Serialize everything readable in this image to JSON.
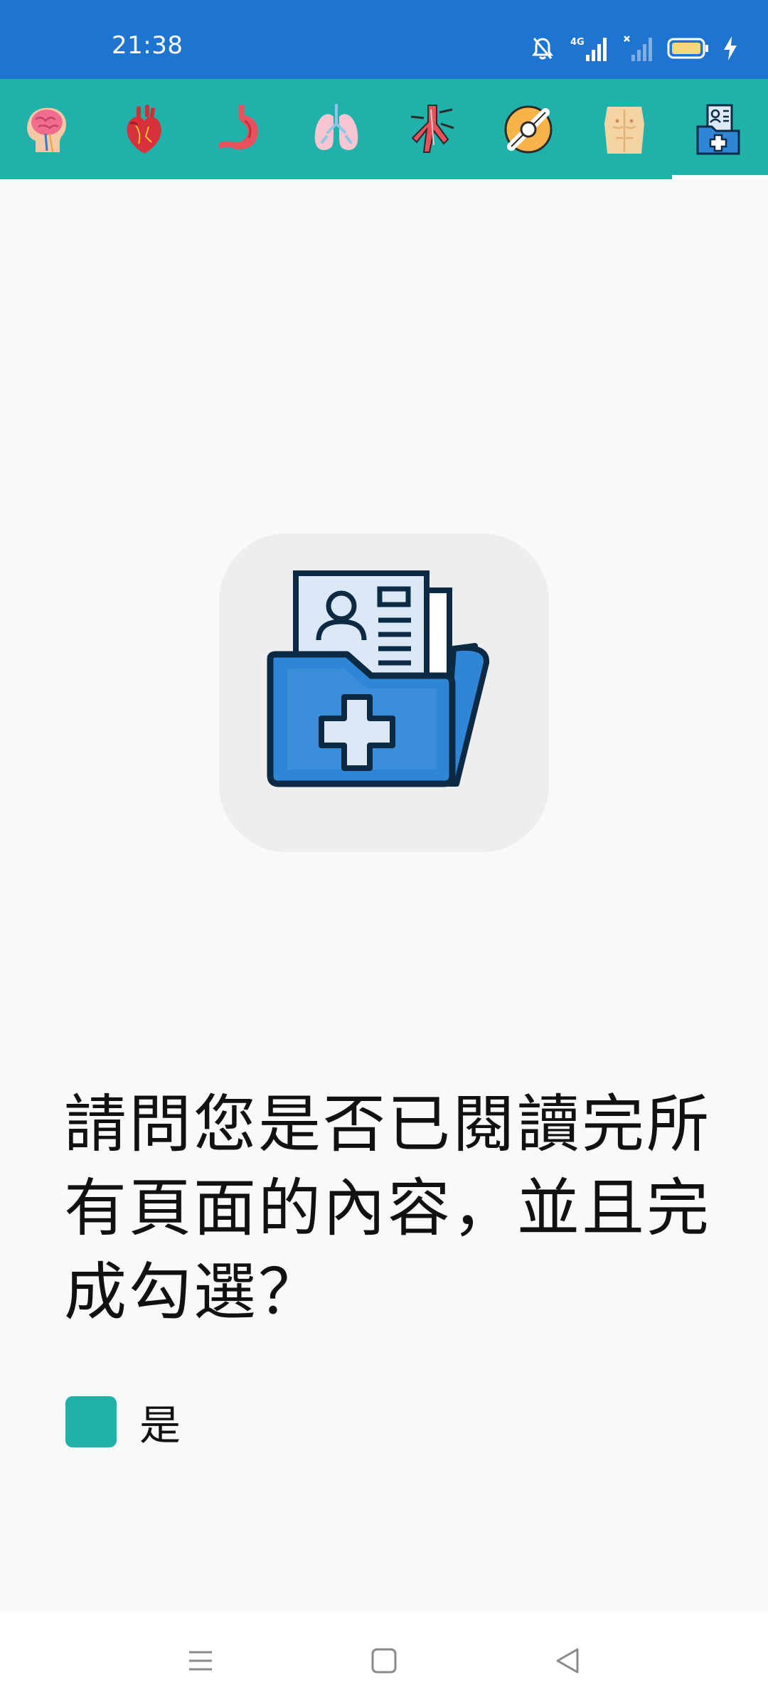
{
  "status_bar": {
    "time": "21:38",
    "network_label": "4G",
    "icons": [
      "mute-bell-icon",
      "signal-4g-icon",
      "signal-no-sim-icon",
      "battery-icon",
      "charging-bolt-icon"
    ]
  },
  "tabs": [
    {
      "icon": "brain-icon",
      "selected": false
    },
    {
      "icon": "heart-icon",
      "selected": false
    },
    {
      "icon": "stomach-icon",
      "selected": false
    },
    {
      "icon": "lungs-icon",
      "selected": false
    },
    {
      "icon": "blood-vessel-icon",
      "selected": false
    },
    {
      "icon": "joint-icon",
      "selected": false
    },
    {
      "icon": "torso-icon",
      "selected": false
    },
    {
      "icon": "medical-record-folder-icon",
      "selected": true
    }
  ],
  "main": {
    "hero_icon": "medical-record-folder-icon",
    "question": "請問您是否已閱讀完所有頁面的內容，並且完成勾選？",
    "option_label": "是",
    "option_checked": false
  },
  "colors": {
    "status_bar": "#1e74d1",
    "tab_bar": "#20b2aa",
    "accent": "#20b2aa",
    "background": "#f8f9fa"
  },
  "nav_bar": {
    "buttons": [
      "menu-icon",
      "home-square-icon",
      "back-triangle-icon"
    ]
  }
}
